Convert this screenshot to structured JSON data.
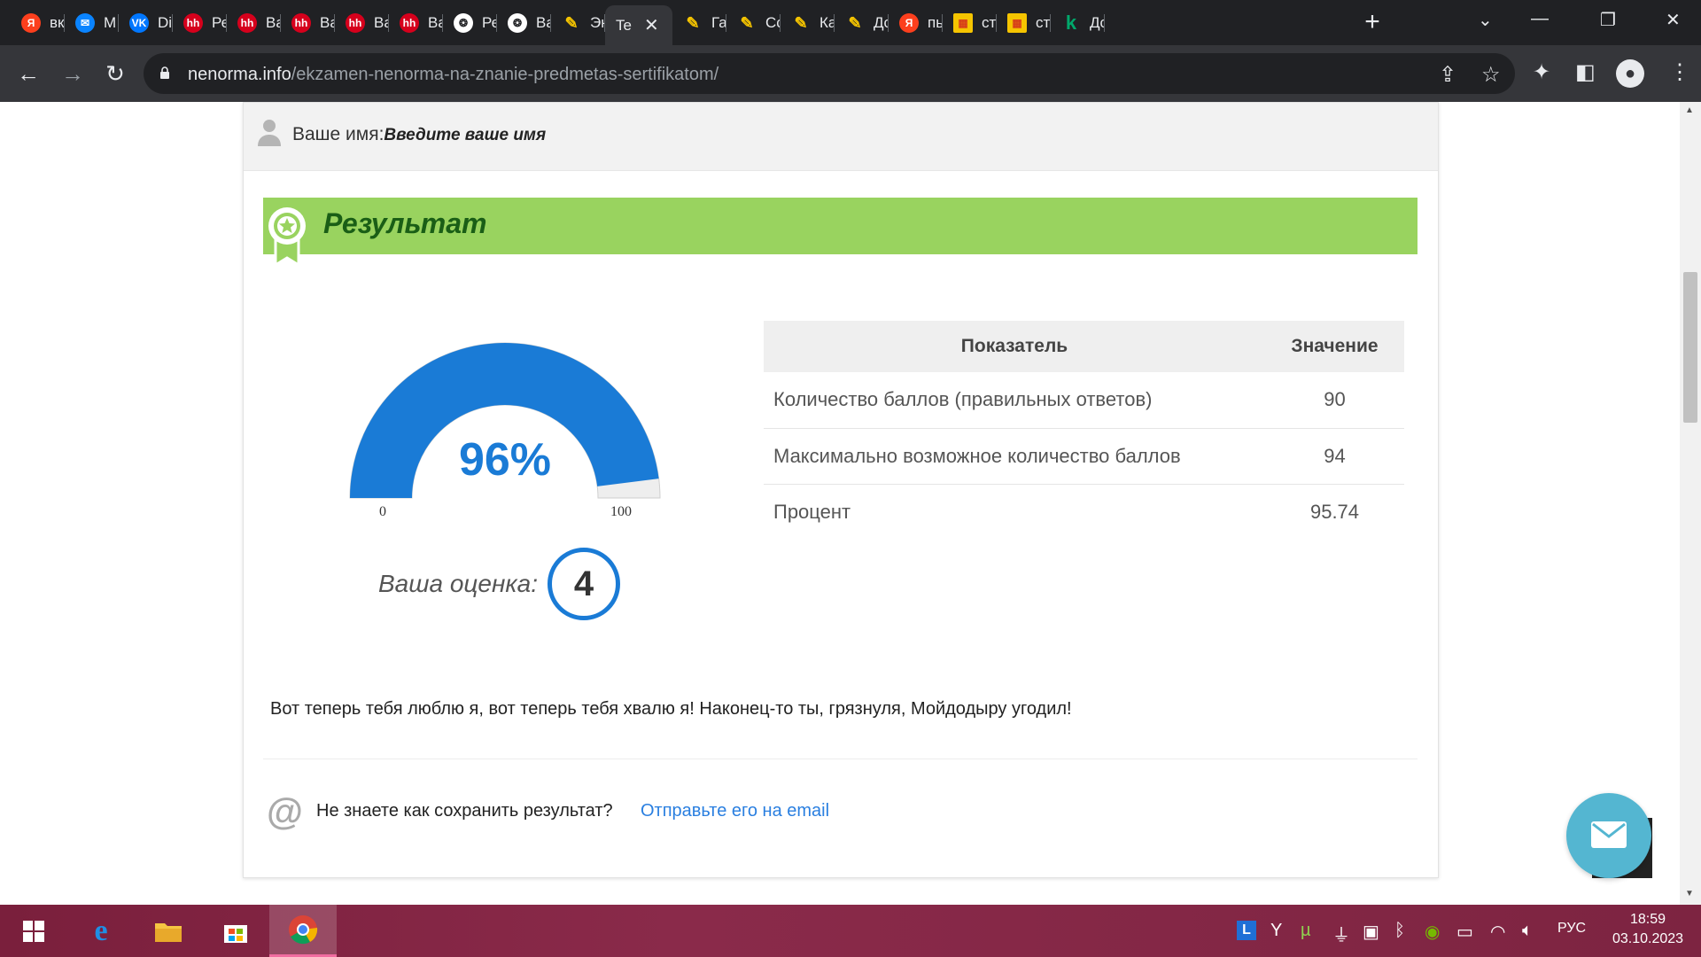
{
  "browser": {
    "tabs": [
      {
        "label": "вк",
        "icon": "yandex-icon",
        "color": "#fc3f1d"
      },
      {
        "label": "М",
        "icon": "chat-icon",
        "color": "#0a84ff"
      },
      {
        "label": "Di",
        "icon": "vk-icon",
        "color": "#0077ff"
      },
      {
        "label": "Ре",
        "icon": "hh-icon",
        "color": "#d6001c"
      },
      {
        "label": "Ва",
        "icon": "hh-icon",
        "color": "#d6001c"
      },
      {
        "label": "Ва",
        "icon": "hh-icon",
        "color": "#d6001c"
      },
      {
        "label": "Ва",
        "icon": "hh-icon",
        "color": "#d6001c"
      },
      {
        "label": "Ва",
        "icon": "hh-icon",
        "color": "#d6001c"
      },
      {
        "label": "Ре",
        "icon": "emblem-icon",
        "color": "#ffffff"
      },
      {
        "label": "Ва",
        "icon": "emblem-icon",
        "color": "#ffffff"
      },
      {
        "label": "Эн",
        "icon": "brush-icon",
        "color": "#f5c400"
      },
      {
        "label": "Te",
        "icon": "",
        "color": "",
        "active": true
      },
      {
        "label": "Га",
        "icon": "brush-icon",
        "color": "#f5c400"
      },
      {
        "label": "Сс",
        "icon": "brush-icon",
        "color": "#f5c400"
      },
      {
        "label": "Ка",
        "icon": "brush-icon",
        "color": "#f5c400"
      },
      {
        "label": "Дс",
        "icon": "brush-icon",
        "color": "#f5c400"
      },
      {
        "label": "пь",
        "icon": "yandex-icon",
        "color": "#fc3f1d"
      },
      {
        "label": "ст",
        "icon": "image-icon",
        "color": "#f5c400"
      },
      {
        "label": "ст",
        "icon": "image-icon",
        "color": "#f5c400"
      },
      {
        "label": "Дс",
        "icon": "k-icon",
        "color": "#00a86b"
      }
    ],
    "url_domain": "nenorma.info",
    "url_path": "/ekzamen-nenorma-na-znanie-predmetas-sertifikatom/"
  },
  "page": {
    "name_label": "Ваше имя:",
    "name_value": "Введите ваше имя",
    "result_title": "Результат",
    "gauge": {
      "value": 96,
      "min": 0,
      "max": 100,
      "display": "96%",
      "min_label": "0",
      "max_label": "100",
      "fill_color": "#1a7bd6",
      "track_color": "#eeeeee"
    },
    "grade_label": "Ваша оценка:",
    "grade_value": "4",
    "table": {
      "headers": [
        "Показатель",
        "Значение"
      ],
      "rows": [
        [
          "Количество баллов (правильных ответов)",
          "90"
        ],
        [
          "Максимально возможное количество баллов",
          "94"
        ],
        [
          "Процент",
          "95.74"
        ]
      ]
    },
    "message": "Вот теперь тебя люблю я, вот теперь тебя хвалю я! Наконец-то ты, грязнуля, Мойдодыру угодил!",
    "save_question": "Не знаете как сохранить результат?",
    "save_link": "Отправьте его на email"
  },
  "taskbar": {
    "language": "РУС",
    "time": "18:59",
    "date": "03.10.2023"
  }
}
